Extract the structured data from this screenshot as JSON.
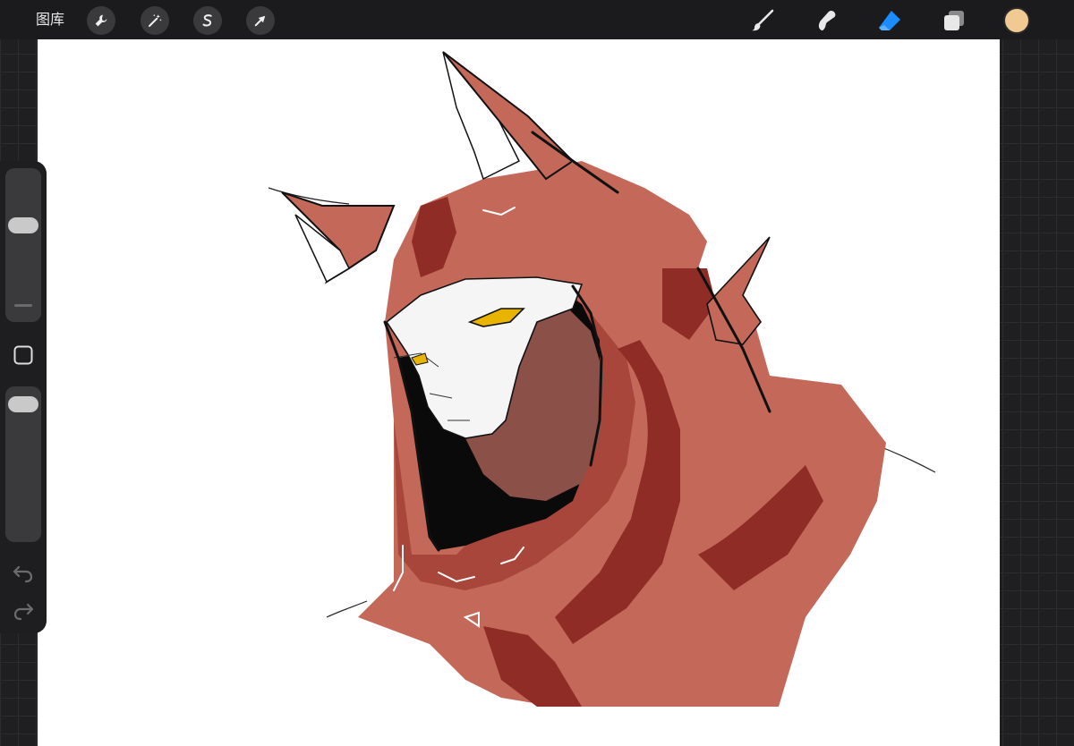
{
  "topbar": {
    "gallery_label": "图库",
    "left_tools": [
      "wrench-icon",
      "magic-wand-icon",
      "selection-s-icon",
      "arrow-icon"
    ],
    "right_tools": [
      "brush-icon",
      "smudge-icon",
      "eraser-icon",
      "layers-icon"
    ],
    "active_tool": "eraser-icon",
    "active_color": "#f1c993",
    "accent_color": "#1a8cff"
  },
  "sidebar": {
    "brush_size_level": 0.65,
    "opacity_level": 0.95,
    "controls": [
      "size-slider",
      "modify-button",
      "opacity-slider",
      "undo-icon",
      "redo-icon"
    ]
  },
  "canvas": {
    "background": "#ffffff",
    "artwork": "red-hooded-figure-sketch",
    "palette": {
      "hood": "#c4685a",
      "shadow": "#962f28",
      "face": "#ffffff",
      "eyes": "#e8b400",
      "ink": "#111111"
    }
  }
}
